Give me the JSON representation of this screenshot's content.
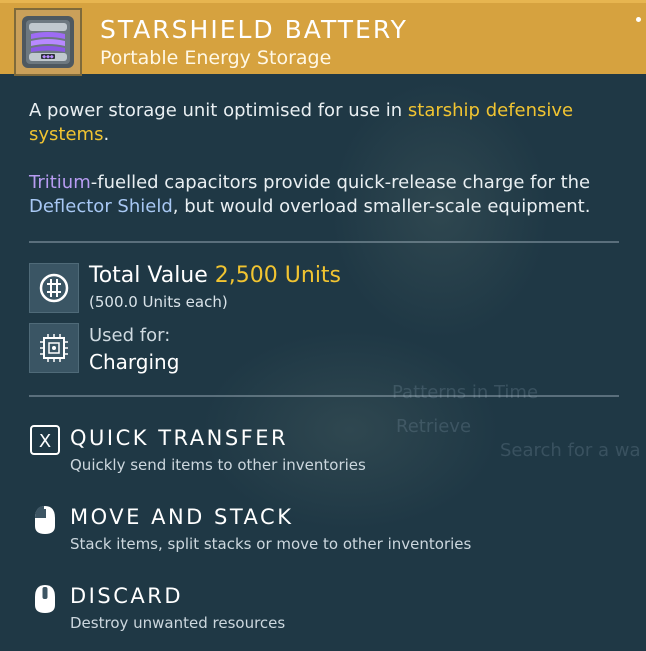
{
  "item": {
    "name": "STARSHIELD BATTERY",
    "category": "Portable Energy Storage",
    "icon": "battery-item-icon"
  },
  "description": {
    "line1_prefix": "A power storage unit optimised for use in ",
    "line1_highlight": "starship defensive",
    "line2_highlight": "systems",
    "line2_suffix": ".",
    "p2_highlight1": "Tritium",
    "p2_text1": "-fuelled capacitors provide quick-release charge for the",
    "p2_highlight2": "Deflector Shield",
    "p2_text2": ", but would overload smaller-scale equipment."
  },
  "value": {
    "label": "Total Value",
    "amount": "2,500 Units",
    "each": "(500.0 Units each)",
    "icon": "units-icon"
  },
  "usage": {
    "label": "Used for:",
    "value": "Charging",
    "icon": "chip-icon"
  },
  "actions": [
    {
      "title": "QUICK TRANSFER",
      "desc": "Quickly send items to other inventories",
      "icon": "x-key-icon"
    },
    {
      "title": "MOVE AND STACK",
      "desc": "Stack items, split stacks or move to other inventories",
      "icon": "left-mouse-icon"
    },
    {
      "title": "DISCARD",
      "desc": "Destroy unwanted resources",
      "icon": "middle-mouse-icon"
    }
  ],
  "background_text": {
    "line1": "Patterns in Time",
    "line2": "Retrieve",
    "line3": "Search for a wa"
  },
  "colors": {
    "header": "#d6a23f",
    "highlight_yellow": "#f1c431",
    "highlight_purple": "#b79cf2",
    "highlight_blue": "#a8c8f4",
    "panel": "#1f3845"
  }
}
